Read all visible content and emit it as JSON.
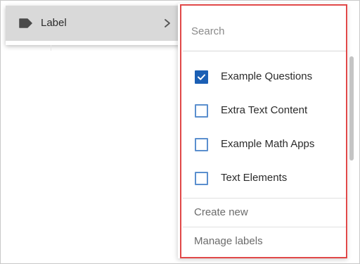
{
  "context_menu": {
    "items": [
      {
        "label": "Label",
        "icon": "tag-icon",
        "submenu_icon": "chevron-right-icon"
      }
    ]
  },
  "label_submenu": {
    "search": {
      "placeholder": "Search",
      "value": ""
    },
    "labels": [
      {
        "label": "Example Questions",
        "checked": true
      },
      {
        "label": "Extra Text Content",
        "checked": false
      },
      {
        "label": "Example Math Apps",
        "checked": false
      },
      {
        "label": "Text Elements",
        "checked": false
      }
    ],
    "create_new": "Create new",
    "manage_labels": "Manage labels"
  },
  "colors": {
    "checkbox_checked": "#1b5fb4",
    "checkbox_border": "#5b8fce",
    "highlight": "#e04848",
    "menu_item_hover": "#d9d9d9"
  }
}
